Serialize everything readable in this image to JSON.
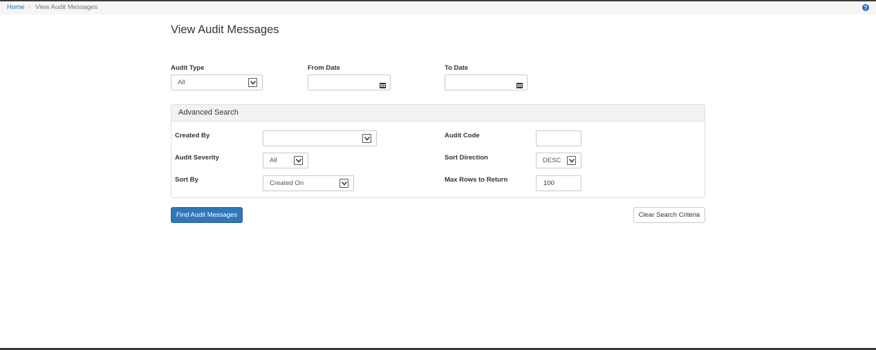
{
  "breadcrumb": {
    "home": "Home",
    "separator": ">",
    "current": "View Audit Messages"
  },
  "page_title": "View Audit Messages",
  "filters": {
    "audit_type": {
      "label": "Audit Type",
      "value": "All"
    },
    "from_date": {
      "label": "From Date",
      "value": ""
    },
    "to_date": {
      "label": "To Date",
      "value": ""
    }
  },
  "advanced_search": {
    "title": "Advanced Search",
    "created_by": {
      "label": "Created By",
      "value": ""
    },
    "audit_severity": {
      "label": "Audit Severity",
      "value": "All"
    },
    "sort_by": {
      "label": "Sort By",
      "value": "Created On"
    },
    "audit_code": {
      "label": "Audit Code",
      "value": ""
    },
    "sort_direction": {
      "label": "Sort Direction",
      "value": "DESC"
    },
    "max_rows": {
      "label": "Max Rows to Return",
      "value": "100"
    }
  },
  "buttons": {
    "find": "Find Audit Messages",
    "clear": "Clear Search Criteria"
  },
  "colors": {
    "primary": "#2f77ba",
    "link": "#2a6ebb",
    "panel_heading": "#f2f2f2"
  },
  "icons": [
    "help-icon",
    "calendar-icon",
    "chevron-down-icon"
  ]
}
